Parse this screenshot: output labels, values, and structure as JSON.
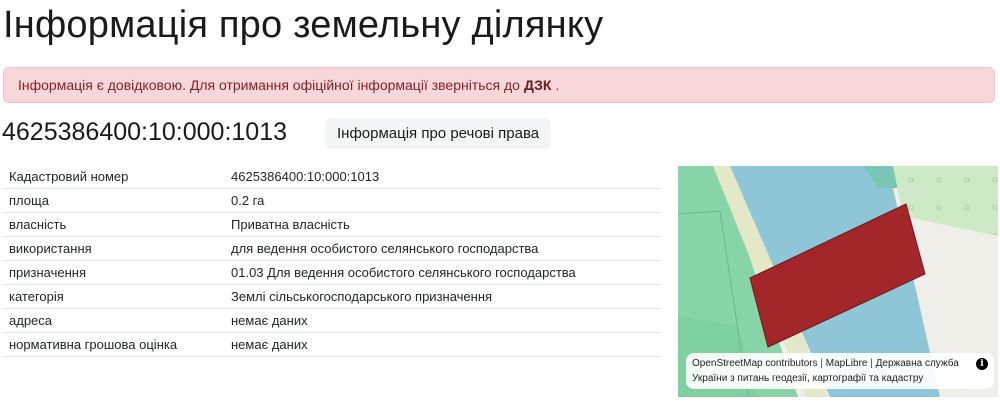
{
  "page": {
    "title": "Інформація про земельну ділянку"
  },
  "alert": {
    "text_before": "Інформація є довідковою. Для отримання офіційної інформації зверніться до",
    "link_label": "ДЗК",
    "text_after": "."
  },
  "parcel": {
    "number": "4625386400:10:000:1013",
    "rights_button_label": "Інформація про речові права"
  },
  "details": [
    {
      "label": "Кадастровий номер",
      "value": "4625386400:10:000:1013"
    },
    {
      "label": "площа",
      "value": "0.2 га"
    },
    {
      "label": "власність",
      "value": "Приватна власність"
    },
    {
      "label": "використання",
      "value": "для ведення особистого селянського господарства"
    },
    {
      "label": "призначення",
      "value": "01.03 Для ведення особистого селянського господарства"
    },
    {
      "label": "категорія",
      "value": "Землі сільськогосподарського призначення"
    },
    {
      "label": "адреса",
      "value": "немає даних"
    },
    {
      "label": "нормативна грошова оцінка",
      "value": "немає даних"
    }
  ],
  "map": {
    "attribution": {
      "osm": "OpenStreetMap contributors",
      "sep": " | ",
      "maplibre": "MapLibre",
      "gov_line1": "Державна служба",
      "gov_line2": "України з питань геодезії, картографії та кадастру"
    },
    "info_icon_glyph": "i",
    "colors": {
      "parcel_fill": "#a3262b",
      "neighbor_fill": "#8ec6d8",
      "green_area": "#86d4a8",
      "background": "#efeee9"
    }
  }
}
